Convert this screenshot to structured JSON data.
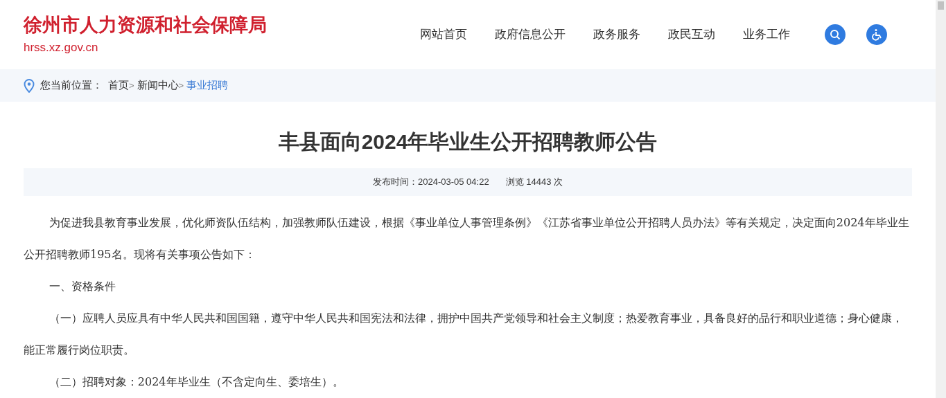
{
  "header": {
    "site_name": "徐州市人力资源和社会保障局",
    "domain": "hrss.xz.gov.cn",
    "nav": [
      "网站首页",
      "政府信息公开",
      "政务服务",
      "政民互动",
      "业务工作"
    ]
  },
  "breadcrumb": {
    "label": "您当前位置：",
    "items": [
      {
        "text": "首页",
        "current": false
      },
      {
        "text": "新闻中心",
        "current": false
      },
      {
        "text": "事业招聘",
        "current": true
      }
    ],
    "separator": ">"
  },
  "article": {
    "title": "丰县面向2024年毕业生公开招聘教师公告",
    "published": "发布时间：2024-03-05 04:22",
    "views": "浏览 14443 次",
    "paragraphs": [
      "为促进我县教育事业发展，优化师资队伍结构，加强教师队伍建设，根据《事业单位人事管理条例》《江苏省事业单位公开招聘人员办法》等有关规定，决定面向2024年毕业生公开招聘教师195名。现将有关事项公告如下：",
      "一、资格条件",
      "（一）应聘人员应具有中华人民共和国国籍，遵守中华人民共和国宪法和法律，拥护中国共产党领导和社会主义制度；热爱教育事业，具备良好的品行和职业道德；身心健康，能正常履行岗位职责。",
      "（二）招聘对象：2024年毕业生（不含定向生、委培生）。"
    ]
  }
}
